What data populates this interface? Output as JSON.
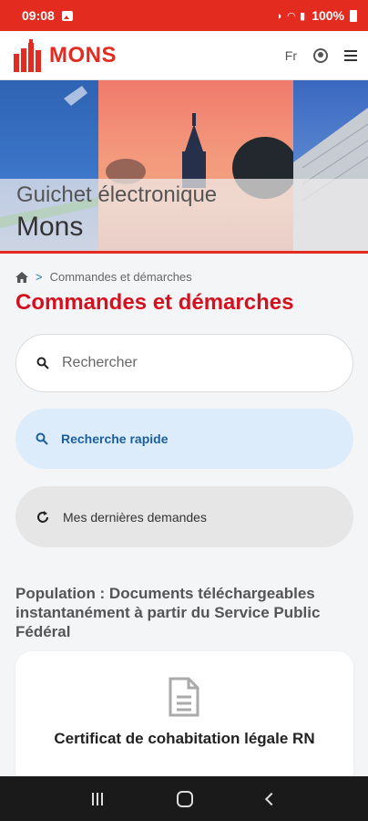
{
  "status_bar": {
    "time": "09:08",
    "battery": "100%",
    "icons": [
      "photo-icon",
      "mute-icon",
      "wifi-icon",
      "signal-icon",
      "battery-icon"
    ]
  },
  "header": {
    "logo_text": "MONS",
    "lang": "Fr",
    "icons": [
      "user-icon",
      "menu-icon"
    ]
  },
  "hero": {
    "subtitle": "Guichet électronique",
    "title": "Mons"
  },
  "breadcrumb": {
    "current": "Commandes et démarches"
  },
  "page_title": "Commandes et démarches",
  "search": {
    "placeholder": "Rechercher"
  },
  "quick_search": {
    "label": "Recherche rapide"
  },
  "recent": {
    "label": "Mes dernières demandes"
  },
  "section": {
    "title": "Population : Documents téléchargeables instantanément à partir du Service Public Fédéral"
  },
  "cards": [
    {
      "title": "Certificat de cohabitation légale RN",
      "icon": "document-icon"
    }
  ],
  "colors": {
    "brand_red": "#e32b20",
    "title_red": "#d4121f",
    "quick_bg": "#dcecfb",
    "quick_text": "#1c5f9c"
  }
}
